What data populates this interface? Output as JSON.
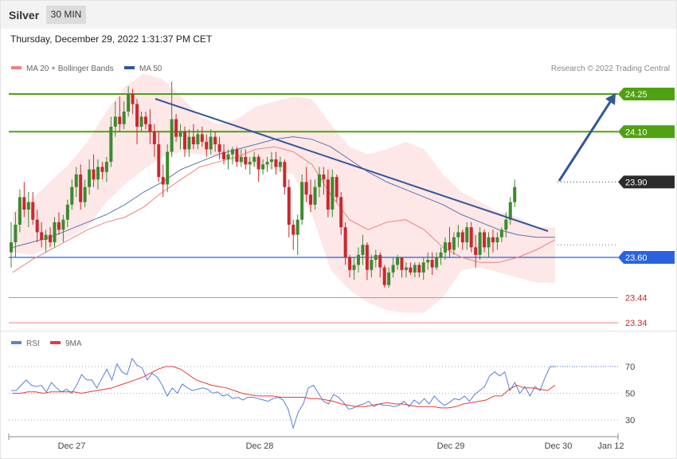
{
  "header": {
    "title": "Silver",
    "timeframe": "30 MIN"
  },
  "datetime": "Thursday, December 29, 2022 1:31:37 PM CET",
  "legend": {
    "ma20": "MA 20 + Bollinger Bands",
    "ma50": "MA 50",
    "credit": "Research © 2022 Trading Central"
  },
  "rsi_legend": {
    "rsi": "RSI",
    "ma9": "9MA"
  },
  "colors": {
    "up": "#3c8a2e",
    "down": "#c9282d",
    "ma20": "#f08080",
    "ma50": "#34569a",
    "band": "#fde3e3",
    "resistance": "#4fa111",
    "pivot": "#2a63e2",
    "support": "#f08080",
    "current": "#2b2b2b",
    "rsi": "#5b7fd6",
    "rsi_ma": "#e33b3b"
  },
  "chart_data": [
    {
      "type": "candlestick",
      "title": "Silver",
      "ylim": [
        23.25,
        24.42
      ],
      "x_labels": [
        "Dec 27",
        "Dec 28",
        "Dec 29",
        "Dec 30",
        "Jan 12"
      ],
      "levels": [
        {
          "value": 24.25,
          "label": "24.25",
          "kind": "resistance"
        },
        {
          "value": 24.1,
          "label": "24.10",
          "kind": "resistance"
        },
        {
          "value": 23.9,
          "label": "23.90",
          "kind": "current"
        },
        {
          "value": 23.6,
          "label": "23.60",
          "kind": "pivot"
        },
        {
          "value": 23.44,
          "label": "23.44",
          "kind": "support"
        },
        {
          "value": 23.34,
          "label": "23.34",
          "kind": "support"
        }
      ],
      "ohlc": [
        [
          23.62,
          23.74,
          23.56,
          23.66
        ],
        [
          23.66,
          23.78,
          23.6,
          23.73
        ],
        [
          23.73,
          23.87,
          23.7,
          23.84
        ],
        [
          23.84,
          23.9,
          23.76,
          23.79
        ],
        [
          23.79,
          23.86,
          23.72,
          23.82
        ],
        [
          23.82,
          23.86,
          23.73,
          23.75
        ],
        [
          23.75,
          23.79,
          23.66,
          23.7
        ],
        [
          23.7,
          23.74,
          23.64,
          23.67
        ],
        [
          23.67,
          23.71,
          23.62,
          23.69
        ],
        [
          23.69,
          23.72,
          23.64,
          23.66
        ],
        [
          23.66,
          23.76,
          23.64,
          23.74
        ],
        [
          23.74,
          23.78,
          23.69,
          23.71
        ],
        [
          23.71,
          23.77,
          23.66,
          23.75
        ],
        [
          23.75,
          23.83,
          23.72,
          23.81
        ],
        [
          23.81,
          23.91,
          23.79,
          23.88
        ],
        [
          23.88,
          23.96,
          23.84,
          23.93
        ],
        [
          23.93,
          23.97,
          23.79,
          23.82
        ],
        [
          23.82,
          23.91,
          23.8,
          23.88
        ],
        [
          23.88,
          23.99,
          23.85,
          23.95
        ],
        [
          23.95,
          24.01,
          23.88,
          23.91
        ],
        [
          23.91,
          23.99,
          23.87,
          23.96
        ],
        [
          23.96,
          23.98,
          23.91,
          23.94
        ],
        [
          23.94,
          24.0,
          23.9,
          23.98
        ],
        [
          23.98,
          24.16,
          23.96,
          24.12
        ],
        [
          24.12,
          24.22,
          24.08,
          24.16
        ],
        [
          24.16,
          24.24,
          24.1,
          24.13
        ],
        [
          24.13,
          24.22,
          24.11,
          24.18
        ],
        [
          24.18,
          24.28,
          24.16,
          24.25
        ],
        [
          24.25,
          24.27,
          24.17,
          24.21
        ],
        [
          24.21,
          24.23,
          24.05,
          24.12
        ],
        [
          24.12,
          24.18,
          24.1,
          24.16
        ],
        [
          24.16,
          24.18,
          24.11,
          24.13
        ],
        [
          24.13,
          24.19,
          24.05,
          24.1
        ],
        [
          24.1,
          24.13,
          24.0,
          24.05
        ],
        [
          24.05,
          24.1,
          23.9,
          23.92
        ],
        [
          23.92,
          23.97,
          23.84,
          23.89
        ],
        [
          23.89,
          24.05,
          23.86,
          24.02
        ],
        [
          24.02,
          24.3,
          24.0,
          24.15
        ],
        [
          24.15,
          24.17,
          24.06,
          24.08
        ],
        [
          24.08,
          24.13,
          24.03,
          24.1
        ],
        [
          24.1,
          24.12,
          24.0,
          24.03
        ],
        [
          24.03,
          24.11,
          24.0,
          24.08
        ],
        [
          24.08,
          24.13,
          24.03,
          24.05
        ],
        [
          24.05,
          24.11,
          24.03,
          24.09
        ],
        [
          24.09,
          24.12,
          24.04,
          24.06
        ],
        [
          24.06,
          24.09,
          24.0,
          24.03
        ],
        [
          24.03,
          24.11,
          24.01,
          24.08
        ],
        [
          24.08,
          24.1,
          24.02,
          24.05
        ],
        [
          24.05,
          24.08,
          23.99,
          24.02
        ],
        [
          24.02,
          24.05,
          23.97,
          23.99
        ],
        [
          23.99,
          24.03,
          23.95,
          24.01
        ],
        [
          24.01,
          24.04,
          23.97,
          24.03
        ],
        [
          24.03,
          24.04,
          23.96,
          23.98
        ],
        [
          23.98,
          24.03,
          23.96,
          24.0
        ],
        [
          24.0,
          24.03,
          23.95,
          23.97
        ],
        [
          23.97,
          24.0,
          23.93,
          23.98
        ],
        [
          23.98,
          24.02,
          23.96,
          24.0
        ],
        [
          24.0,
          24.01,
          23.9,
          23.95
        ],
        [
          23.95,
          23.99,
          23.93,
          23.97
        ],
        [
          23.97,
          24.0,
          23.94,
          23.98
        ],
        [
          23.98,
          24.02,
          23.95,
          23.99
        ],
        [
          23.99,
          24.02,
          23.93,
          23.96
        ],
        [
          23.96,
          24.0,
          23.94,
          23.98
        ],
        [
          23.98,
          23.99,
          23.85,
          23.88
        ],
        [
          23.88,
          23.91,
          23.68,
          23.73
        ],
        [
          23.73,
          23.75,
          23.63,
          23.69
        ],
        [
          23.69,
          23.77,
          23.61,
          23.75
        ],
        [
          23.75,
          23.93,
          23.73,
          23.9
        ],
        [
          23.9,
          23.96,
          23.82,
          23.85
        ],
        [
          23.85,
          23.91,
          23.78,
          23.81
        ],
        [
          23.81,
          23.91,
          23.79,
          23.88
        ],
        [
          23.88,
          23.96,
          23.84,
          23.93
        ],
        [
          23.93,
          23.96,
          23.85,
          23.91
        ],
        [
          23.91,
          23.95,
          23.76,
          23.79
        ],
        [
          23.79,
          23.95,
          23.76,
          23.92
        ],
        [
          23.92,
          23.93,
          23.82,
          23.84
        ],
        [
          23.84,
          23.86,
          23.69,
          23.72
        ],
        [
          23.72,
          23.74,
          23.57,
          23.6
        ],
        [
          23.6,
          23.61,
          23.52,
          23.55
        ],
        [
          23.55,
          23.6,
          23.51,
          23.57
        ],
        [
          23.57,
          23.64,
          23.54,
          23.61
        ],
        [
          23.61,
          23.69,
          23.57,
          23.65
        ],
        [
          23.65,
          23.66,
          23.51,
          23.55
        ],
        [
          23.55,
          23.61,
          23.52,
          23.59
        ],
        [
          23.59,
          23.63,
          23.56,
          23.61
        ],
        [
          23.61,
          23.62,
          23.52,
          23.56
        ],
        [
          23.56,
          23.57,
          23.48,
          23.49
        ],
        [
          23.49,
          23.56,
          23.48,
          23.54
        ],
        [
          23.54,
          23.6,
          23.52,
          23.57
        ],
        [
          23.57,
          23.61,
          23.55,
          23.6
        ],
        [
          23.6,
          23.6,
          23.52,
          23.55
        ],
        [
          23.55,
          23.58,
          23.52,
          23.56
        ],
        [
          23.56,
          23.58,
          23.53,
          23.54
        ],
        [
          23.54,
          23.58,
          23.52,
          23.57
        ],
        [
          23.57,
          23.58,
          23.52,
          23.54
        ],
        [
          23.54,
          23.6,
          23.51,
          23.58
        ],
        [
          23.58,
          23.62,
          23.55,
          23.59
        ],
        [
          23.59,
          23.62,
          23.53,
          23.56
        ],
        [
          23.56,
          23.62,
          23.55,
          23.6
        ],
        [
          23.6,
          23.64,
          23.57,
          23.62
        ],
        [
          23.62,
          23.68,
          23.59,
          23.66
        ],
        [
          23.66,
          23.72,
          23.6,
          23.63
        ],
        [
          23.63,
          23.7,
          23.61,
          23.68
        ],
        [
          23.68,
          23.73,
          23.64,
          23.7
        ],
        [
          23.7,
          23.71,
          23.63,
          23.66
        ],
        [
          23.66,
          23.74,
          23.63,
          23.72
        ],
        [
          23.72,
          23.74,
          23.62,
          23.64
        ],
        [
          23.64,
          23.69,
          23.56,
          23.61
        ],
        [
          23.61,
          23.72,
          23.59,
          23.7
        ],
        [
          23.7,
          23.71,
          23.62,
          23.64
        ],
        [
          23.64,
          23.7,
          23.6,
          23.68
        ],
        [
          23.68,
          23.71,
          23.62,
          23.66
        ],
        [
          23.66,
          23.7,
          23.63,
          23.68
        ],
        [
          23.68,
          23.72,
          23.66,
          23.71
        ],
        [
          23.71,
          23.78,
          23.68,
          23.75
        ],
        [
          23.75,
          23.84,
          23.73,
          23.82
        ],
        [
          23.82,
          23.91,
          23.8,
          23.88
        ]
      ],
      "ma20": [
        23.54,
        23.59,
        23.63,
        23.67,
        23.71,
        23.74,
        23.76,
        23.8,
        23.86,
        23.91,
        23.96,
        23.98,
        24.0,
        24.03,
        24.04,
        24.02,
        23.97,
        23.85,
        23.75,
        23.71,
        23.74,
        23.75,
        23.71,
        23.64,
        23.6,
        23.58,
        23.58,
        23.6,
        23.63,
        23.67
      ],
      "ma50": [
        23.64,
        23.66,
        23.68,
        23.71,
        23.74,
        23.77,
        23.81,
        23.86,
        23.9,
        23.95,
        23.98,
        24.01,
        24.03,
        24.05,
        24.07,
        24.08,
        24.07,
        24.04,
        23.99,
        23.94,
        23.9,
        23.87,
        23.84,
        23.81,
        23.77,
        23.74,
        23.71,
        23.69,
        23.68,
        23.68
      ],
      "bb_upper": [
        23.78,
        23.83,
        23.9,
        23.97,
        24.06,
        24.18,
        24.28,
        24.33,
        24.31,
        24.24,
        24.16,
        24.13,
        24.15,
        24.2,
        24.22,
        24.24,
        24.23,
        24.13,
        24.04,
        24.01,
        24.03,
        24.06,
        24.03,
        23.93,
        23.86,
        23.82,
        23.78,
        23.76,
        23.72,
        23.72
      ],
      "bb_lower": [
        23.62,
        23.61,
        23.64,
        23.68,
        23.72,
        23.82,
        23.89,
        23.95,
        24.0,
        24.02,
        24.01,
        24.0,
        23.98,
        23.96,
        23.95,
        23.93,
        23.77,
        23.55,
        23.47,
        23.42,
        23.39,
        23.38,
        23.38,
        23.44,
        23.55,
        23.56,
        23.54,
        23.52,
        23.5,
        23.5
      ]
    },
    {
      "type": "line",
      "title": "RSI",
      "ylim": [
        10,
        90
      ],
      "yticks": [
        30,
        50,
        70
      ],
      "series": [
        {
          "name": "RSI",
          "values": [
            52,
            52,
            56,
            60,
            56,
            55,
            56,
            51,
            58,
            54,
            51,
            53,
            50,
            56,
            64,
            60,
            60,
            54,
            61,
            68,
            60,
            72,
            66,
            64,
            76,
            71,
            69,
            60,
            65,
            62,
            56,
            48,
            54,
            50,
            57,
            54,
            52,
            53,
            54,
            53,
            50,
            51,
            48,
            49,
            46,
            47,
            45,
            47,
            47,
            46,
            45,
            44,
            46,
            47,
            45,
            38,
            24,
            36,
            42,
            54,
            56,
            50,
            44,
            42,
            49,
            47,
            43,
            38,
            39,
            41,
            42,
            44,
            40,
            42,
            41,
            41,
            40,
            41,
            44,
            40,
            45,
            42,
            46,
            42,
            48,
            44,
            41,
            43,
            46,
            45,
            48,
            44,
            49,
            52,
            55,
            63,
            66,
            63,
            66,
            52,
            58,
            50,
            55,
            48,
            55,
            52,
            62,
            70,
            70
          ]
        },
        {
          "name": "9MA",
          "values": [
            50,
            50,
            51,
            51,
            50,
            51,
            51,
            51,
            51,
            50,
            51,
            52,
            53,
            54,
            56,
            58,
            60,
            62,
            65,
            68,
            70,
            70,
            68,
            64,
            60,
            58,
            56,
            55,
            54,
            52,
            50,
            49,
            48,
            48,
            48,
            47,
            47,
            47,
            47,
            46,
            46,
            45,
            44,
            42,
            41,
            40,
            40,
            41,
            42,
            43,
            42,
            42,
            41,
            40,
            40,
            40,
            39,
            39,
            40,
            42,
            43,
            44,
            45,
            48,
            48,
            53,
            56,
            54,
            54,
            53,
            52,
            56
          ]
        }
      ]
    }
  ]
}
